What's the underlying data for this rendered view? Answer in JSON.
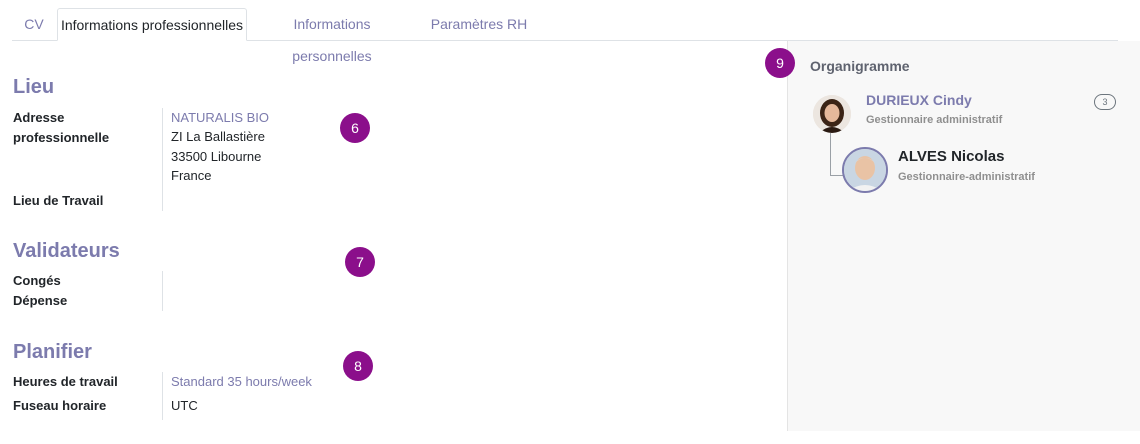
{
  "tabs": [
    {
      "label": "CV"
    },
    {
      "label": "Informations professionnelles"
    },
    {
      "label": "Informations personnelles"
    },
    {
      "label": "Paramètres RH"
    }
  ],
  "lieu": {
    "title": "Lieu",
    "address_label": "Adresse professionnelle",
    "company": "NATURALIS BIO",
    "street": "ZI La Ballastière",
    "city": "33500 Libourne",
    "country": "France",
    "work_location_label": "Lieu de Travail"
  },
  "validateurs": {
    "title": "Validateurs",
    "leave_label": "Congés",
    "expense_label": "Dépense"
  },
  "planifier": {
    "title": "Planifier",
    "hours_label": "Heures de travail",
    "hours_value": "Standard 35 hours/week",
    "tz_label": "Fuseau horaire",
    "tz_value": "UTC"
  },
  "badges": [
    "6",
    "7",
    "8",
    "9"
  ],
  "org": {
    "title": "Organigramme",
    "manager": {
      "name": "DURIEUX Cindy",
      "job": "Gestionnaire administratif",
      "count": "3"
    },
    "employee": {
      "name": "ALVES Nicolas",
      "job": "Gestionnaire-administratif"
    }
  },
  "colors": {
    "accent": "#7c7bad",
    "badge": "#8b0f8b"
  }
}
